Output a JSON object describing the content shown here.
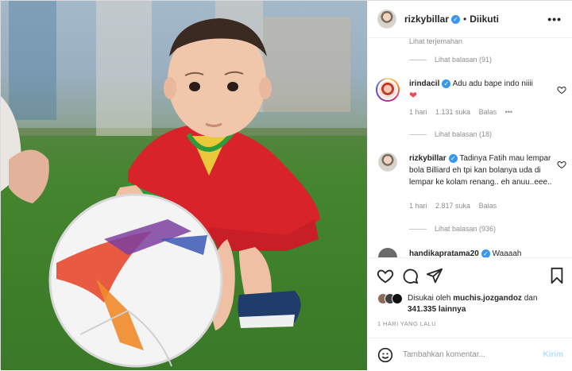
{
  "header": {
    "username": "rizkybillar",
    "separator": "•",
    "follow_status": "Diikuti",
    "more_icon": "more-horizontal-icon"
  },
  "comments_section": {
    "see_translation": "Lihat terjemahan",
    "view_replies_1": "Lihat balasan (91)",
    "comments": [
      {
        "username": "irindacil",
        "text": "Adu adu bape indo niiii",
        "emoji": "❤",
        "time": "1 hari",
        "likes": "1.131 suka",
        "reply": "Balas",
        "options": "•••",
        "view_replies": "Lihat balasan (18)"
      },
      {
        "username": "rizkybillar",
        "text": "Tadinya Fatih mau lempar bola Billiard eh tpi kan bolanya uda di lempar ke kolam renang.. eh anuu..eee..",
        "time": "1 hari",
        "likes": "2.817 suka",
        "reply": "Balas",
        "view_replies": "Lihat balasan (936)"
      },
      {
        "username": "handikapratama20",
        "text": "Waaaah"
      }
    ]
  },
  "actions": {
    "like_icon": "heart-icon",
    "comment_icon": "comment-icon",
    "share_icon": "share-icon",
    "save_icon": "bookmark-icon",
    "liked_by_prefix": "Disukai oleh",
    "liked_by_user": "muchis.jozgandoz",
    "liked_by_conj": "dan",
    "liked_by_others": "341.335 lainnya",
    "post_date": "1 HARI YANG LALU"
  },
  "add_comment": {
    "emoji_icon": "emoji-smile-icon",
    "placeholder": "Tambahkan komentar...",
    "post_label": "Kirim"
  },
  "colors": {
    "verified": "#3897f0",
    "muted": "#8e8e8e",
    "post_disabled": "#b2dffc",
    "heart_red": "#ed4956"
  }
}
